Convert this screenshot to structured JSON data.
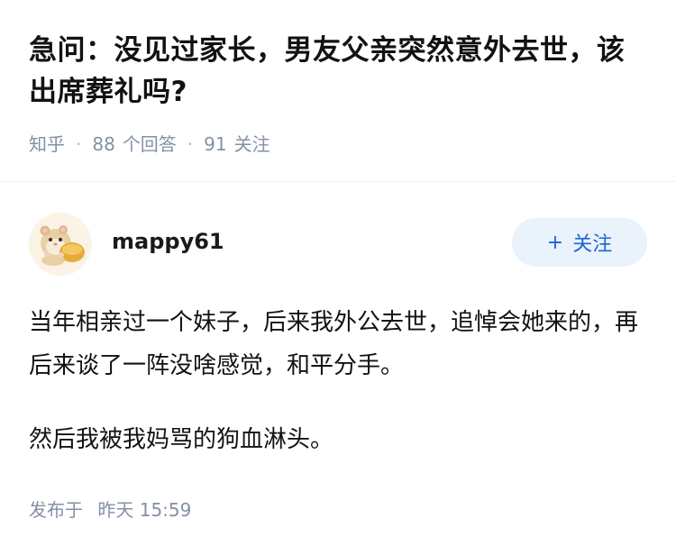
{
  "question": {
    "title": "急问：没见过家长，男友父亲突然意外去世，该出席葬礼吗?",
    "meta": {
      "source": "知乎",
      "answers_count": "88",
      "answers_label": "个回答",
      "followers_count": "91",
      "followers_label": "关注"
    }
  },
  "answer": {
    "author": {
      "name": "mappy61",
      "avatar_icon": "hamster-avatar-icon"
    },
    "follow_button": {
      "icon": "+",
      "label": "关注"
    },
    "paragraphs": [
      "当年相亲过一个妹子，后来我外公去世，追悼会她来的，再后来谈了一阵没啥感觉，和平分手。",
      "然后我被我妈骂的狗血淋头。"
    ],
    "published": {
      "label": "发布于",
      "time": "昨天 15:59"
    }
  },
  "colors": {
    "primary_text": "#121212",
    "meta_text": "#8590a6",
    "follow_accent": "#1a66d6",
    "follow_bg": "#eaf2fb"
  }
}
